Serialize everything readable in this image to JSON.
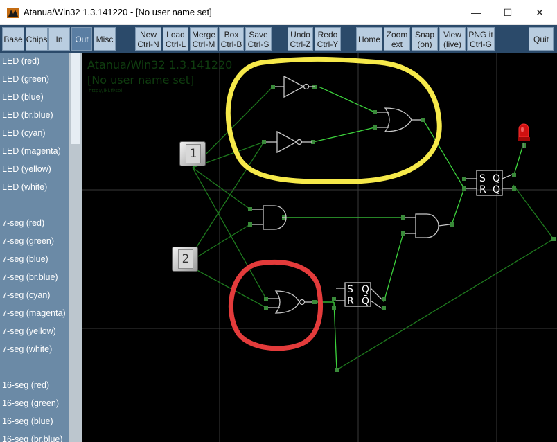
{
  "window": {
    "title": "Atanua/Win32 1.3.141220 - [No user name set]",
    "controls": {
      "minimize": "—",
      "maximize": "☐",
      "close": "✕"
    }
  },
  "toolbar": {
    "buttons": [
      {
        "label": "Base",
        "active": false
      },
      {
        "label": "Chips",
        "active": false
      },
      {
        "label": "In",
        "active": false
      },
      {
        "label": "Out",
        "active": true
      },
      {
        "label": "Misc",
        "active": false
      },
      {
        "label": "New\nCtrl-N",
        "active": false
      },
      {
        "label": "Load\nCtrl-L",
        "active": false
      },
      {
        "label": "Merge\nCtrl-M",
        "active": false
      },
      {
        "label": "Box\nCtrl-B",
        "active": false
      },
      {
        "label": "Save\nCtrl-S",
        "active": false
      },
      {
        "label": "Undo\nCtrl-Z",
        "active": false
      },
      {
        "label": "Redo\nCtrl-Y",
        "active": false
      },
      {
        "label": "Home",
        "active": false
      },
      {
        "label": "Zoom\next",
        "active": false
      },
      {
        "label": "Snap\n(on)",
        "active": false
      },
      {
        "label": "View\n(live)",
        "active": false
      },
      {
        "label": "PNG it\nCtrl-G",
        "active": false
      },
      {
        "label": "Quit",
        "active": false
      }
    ]
  },
  "sidebar": {
    "items": [
      "LED (red)",
      "LED (green)",
      "LED (blue)",
      "LED (br.blue)",
      "LED (cyan)",
      "LED (magenta)",
      "LED (yellow)",
      "LED (white)",
      "7-seg (red)",
      "7-seg (green)",
      "7-seg (blue)",
      "7-seg (br.blue)",
      "7-seg (cyan)",
      "7-seg (magenta)",
      "7-seg (yellow)",
      "7-seg (white)",
      "16-seg (red)",
      "16-seg (green)",
      "16-seg (blue)",
      "16-seg (br.blue)"
    ]
  },
  "canvas": {
    "watermark_title": "Atanua/Win32 1.3.141220",
    "watermark_user": "[No user name set]",
    "watermark_url": "http://iki.fi/sol",
    "key1_label": "1",
    "key2_label": "2",
    "sr_latch_labels": {
      "s": "S",
      "r": "R",
      "q": "Q",
      "qbar": "Q̄"
    },
    "colors": {
      "wire_active": "#3cd23c",
      "wire_inactive": "#1e7a1e",
      "gate": "#c8c8c8",
      "annotation_yellow": "#f6e94a",
      "annotation_red": "#e33b3b",
      "led": "#e01010"
    }
  }
}
